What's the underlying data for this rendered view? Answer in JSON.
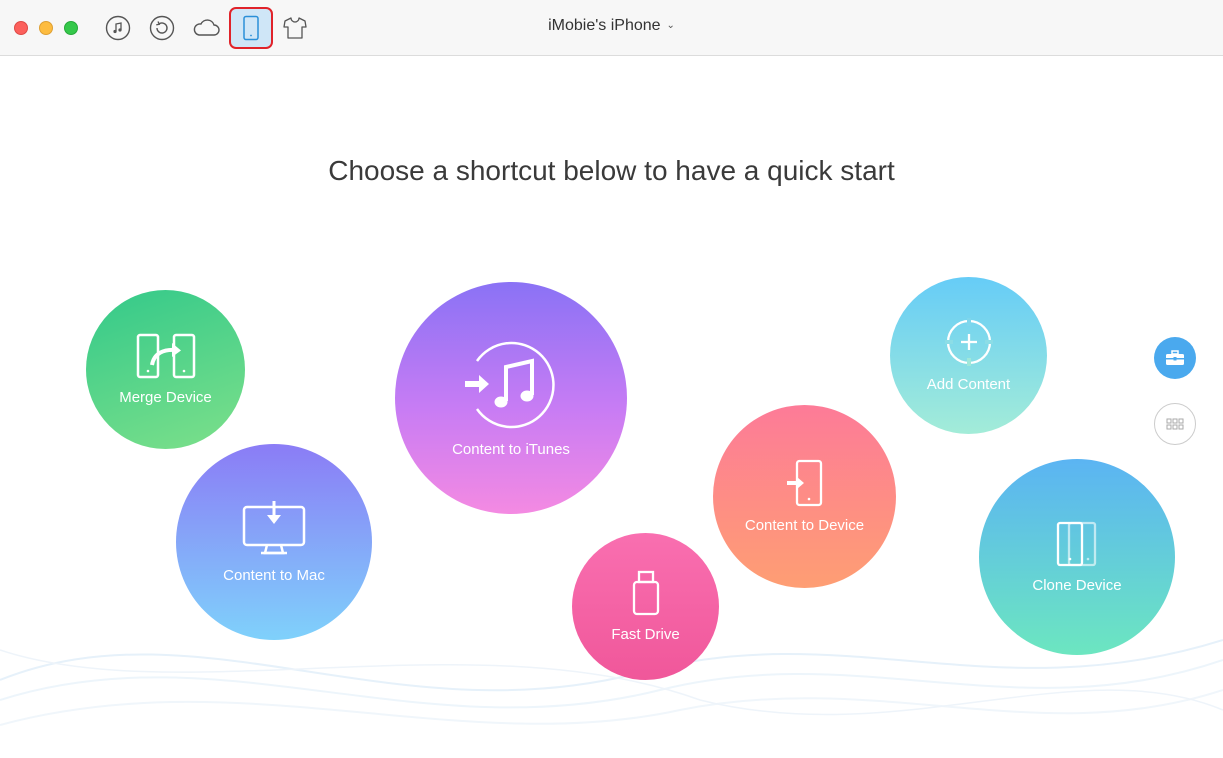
{
  "window": {
    "device_name": "iMobie's iPhone"
  },
  "toolbar": {
    "buttons": [
      {
        "icon": "music-icon"
      },
      {
        "icon": "backup-icon"
      },
      {
        "icon": "cloud-icon"
      },
      {
        "icon": "phone-icon",
        "active": true
      },
      {
        "icon": "tshirt-icon"
      }
    ]
  },
  "main": {
    "heading": "Choose a shortcut below to have a quick start",
    "shortcuts": [
      {
        "label": "Merge Device",
        "icon": "merge-device-icon"
      },
      {
        "label": "Content to Mac",
        "icon": "content-to-mac-icon"
      },
      {
        "label": "Content to iTunes",
        "icon": "content-to-itunes-icon"
      },
      {
        "label": "Fast Drive",
        "icon": "fast-drive-icon"
      },
      {
        "label": "Content to Device",
        "icon": "content-to-device-icon"
      },
      {
        "label": "Add Content",
        "icon": "add-content-icon"
      },
      {
        "label": "Clone Device",
        "icon": "clone-device-icon"
      }
    ]
  },
  "side": {
    "toolkit_icon": "toolkit-icon",
    "grid_icon": "grid-icon"
  },
  "colors": {
    "accent": "#4aa9ee",
    "active_outline": "#e0232a"
  }
}
